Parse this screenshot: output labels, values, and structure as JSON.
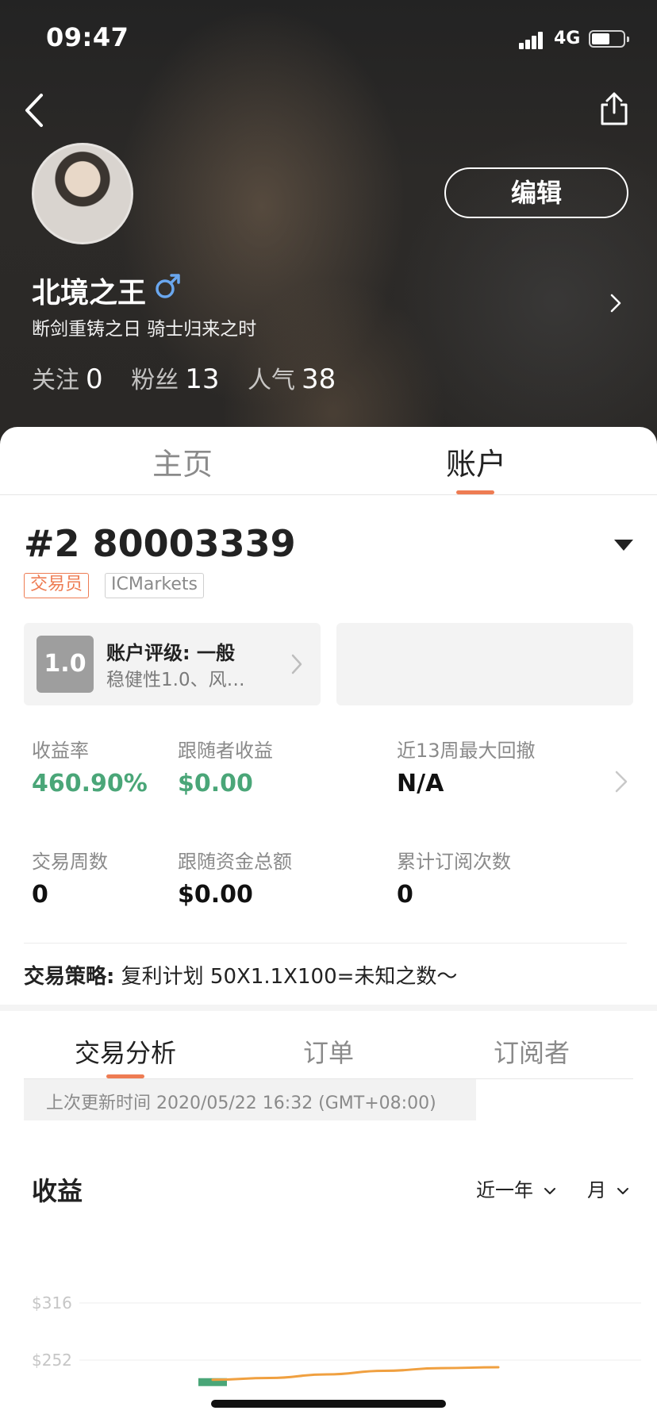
{
  "status_bar": {
    "time": "09:47",
    "network": "4G"
  },
  "profile": {
    "username": "北境之王",
    "signature": "断剑重铸之日 骑士归来之时",
    "edit_label": "编辑",
    "stats": [
      {
        "label": "关注",
        "value": "0"
      },
      {
        "label": "粉丝",
        "value": "13"
      },
      {
        "label": "人气",
        "value": "38"
      }
    ]
  },
  "main_tabs": [
    {
      "label": "主页",
      "active": false
    },
    {
      "label": "账户",
      "active": true
    }
  ],
  "account": {
    "number": "#2 80003339",
    "role_badge": "交易员",
    "broker_badge": "ICMarkets",
    "rating_score": "1.0",
    "rating_title": "账户评级: 一般",
    "rating_sub": "稳健性1.0、风…"
  },
  "metrics": [
    {
      "label": "收益率",
      "value": "460.90%",
      "color": "#4aa678"
    },
    {
      "label": "跟随者收益",
      "value": "$0.00",
      "color": "#4aa678"
    },
    {
      "label": "近13周最大回撤",
      "value": "N/A",
      "color": "#111111"
    },
    {
      "label": "交易周数",
      "value": "0",
      "color": "#111111"
    },
    {
      "label": "跟随资金总额",
      "value": "$0.00",
      "color": "#111111"
    },
    {
      "label": "累计订阅次数",
      "value": "0",
      "color": "#111111"
    }
  ],
  "strategy": {
    "label": "交易策略:",
    "text": "复利计划 50X1.1X100=未知之数～"
  },
  "sub_tabs": [
    {
      "label": "交易分析",
      "active": true
    },
    {
      "label": "订单",
      "active": false
    },
    {
      "label": "订阅者",
      "active": false
    }
  ],
  "update_text": "上次更新时间 2020/05/22 16:32 (GMT+08:00)",
  "chart_section": {
    "title": "收益",
    "period": "近一年",
    "unit": "月"
  },
  "colors": {
    "accent": "#ee7c53",
    "positive": "#4aa678",
    "line": "#f0a040"
  },
  "chart_data": {
    "type": "line",
    "title": "收益",
    "y_ticks": [
      "$316",
      "$252"
    ],
    "series": [
      {
        "values": [
          230,
          232,
          236,
          240,
          243,
          244
        ]
      }
    ],
    "bars": [
      {
        "value": 5,
        "color": "#4aa678"
      }
    ],
    "ylim": [
      188,
      316
    ],
    "grid": true
  }
}
